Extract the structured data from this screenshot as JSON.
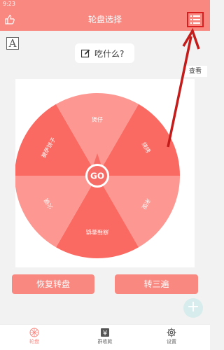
{
  "status_bar": {
    "time": "9:23"
  },
  "app_bar": {
    "title": "轮盘选择"
  },
  "font_button": {
    "glyph": "A"
  },
  "question": {
    "text": "吃什么?"
  },
  "tooltip": {
    "text": "查看"
  },
  "wheel": {
    "center_label": "GO",
    "colors": {
      "dark": "#fb6a62",
      "light": "#fd9791",
      "center": "#f56d66"
    },
    "segments": [
      {
        "label": "披萨饼子"
      },
      {
        "label": "煲仔"
      },
      {
        "label": "烧烤"
      },
      {
        "label": "米饭"
      },
      {
        "label": "麻辣香锅"
      },
      {
        "label": "火锅"
      }
    ]
  },
  "buttons": {
    "reset": "恢复转盘",
    "spin_three": "转三遍"
  },
  "fab": {
    "icon": "plus-icon"
  },
  "bottom_nav": [
    {
      "label": "轮盘",
      "icon": "wheel-icon",
      "active": true
    },
    {
      "label": "群收款",
      "icon": "yen-icon",
      "active": false
    },
    {
      "label": "设置",
      "icon": "gear-icon",
      "active": false
    }
  ],
  "colors": {
    "accent": "#f98880",
    "highlight_red": "#d81e1e"
  }
}
